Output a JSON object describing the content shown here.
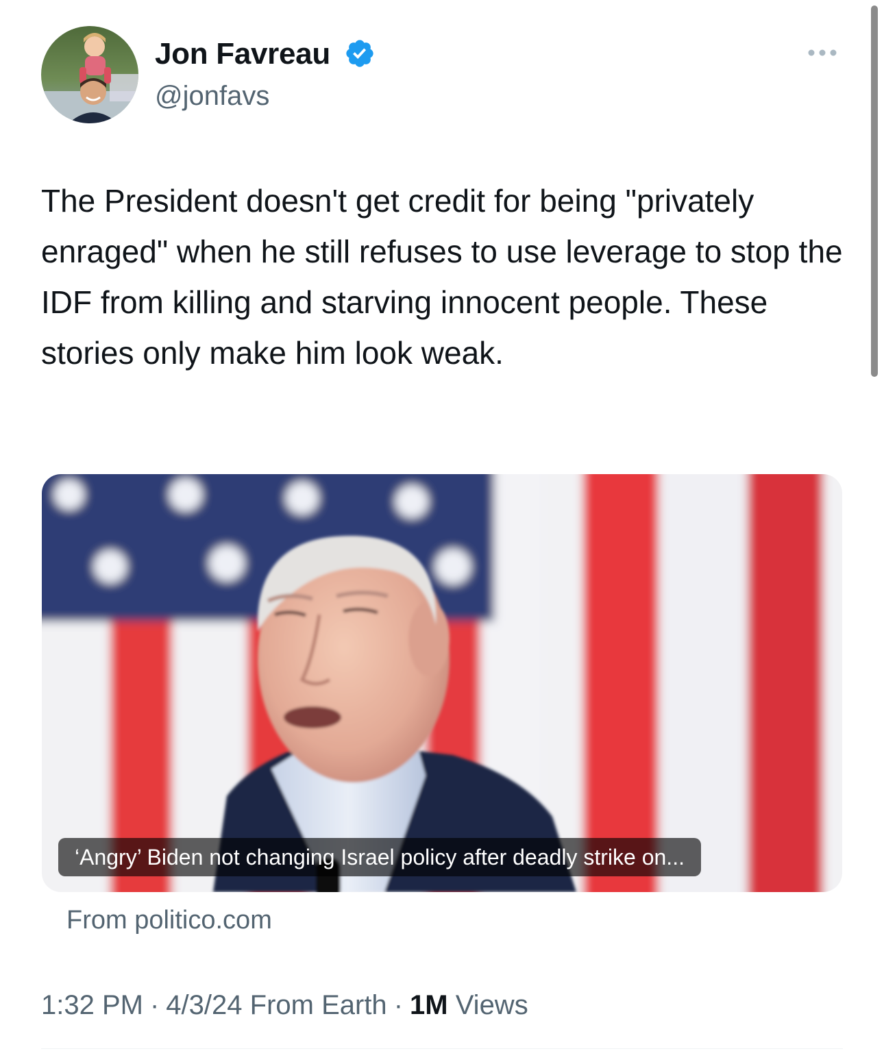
{
  "author": {
    "name": "Jon Favreau",
    "handle": "@jonfavs",
    "verified": true,
    "avatar_icon": "profile-photo"
  },
  "tweet": {
    "text": "The President doesn't get credit for being \"privately enraged\" when he still refuses to use leverage to stop the IDF from killing and starving innocent people. These stories only make him look weak."
  },
  "link_card": {
    "caption": "‘Angry’ Biden not changing Israel policy after deadly strike on...",
    "source": "From politico.com"
  },
  "meta": {
    "time": "1:32 PM",
    "date": "4/3/24",
    "location": "From Earth",
    "separator": "·",
    "views_count": "1M",
    "views_label": "Views"
  },
  "colors": {
    "verified_blue": "#1d9bf0",
    "secondary_text": "#536471",
    "primary_text": "#0f1419"
  }
}
